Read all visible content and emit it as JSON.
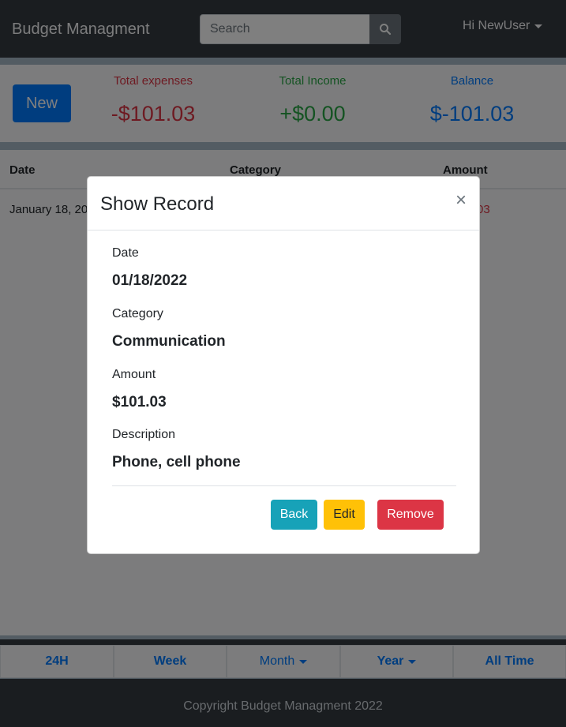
{
  "navbar": {
    "brand": "Budget Managment",
    "search_placeholder": "Search",
    "user_greeting": "Hi NewUser"
  },
  "summary": {
    "new_label": "New",
    "expenses_label": "Total expenses",
    "expenses_value": "-$101.03",
    "income_label": "Total Income",
    "income_value": "+$0.00",
    "balance_label": "Balance",
    "balance_value": "$-101.03"
  },
  "table": {
    "headers": [
      "Date",
      "Category",
      "Amount"
    ],
    "rows": [
      {
        "date": "January 18, 20",
        "amount_tail": "03"
      }
    ]
  },
  "period_tabs": [
    {
      "label": "24H"
    },
    {
      "label": "Week"
    },
    {
      "label": "Month"
    },
    {
      "label": "Year"
    },
    {
      "label": "All Time"
    }
  ],
  "footer": "Copyright Budget Managment 2022",
  "modal": {
    "title": "Show Record",
    "close": "×",
    "fields": [
      {
        "label": "Date",
        "value": "01/18/2022"
      },
      {
        "label": "Category",
        "value": "Communication"
      },
      {
        "label": "Amount",
        "value": "$101.03"
      },
      {
        "label": "Description",
        "value": "Phone, cell phone"
      }
    ],
    "back_label": "Back",
    "edit_label": "Edit",
    "remove_label": "Remove"
  },
  "colors": {
    "primary": "#007bff",
    "danger": "#dc3545",
    "success": "#28a745",
    "info": "#17a2b8",
    "warning": "#ffc107",
    "dark": "#343a40"
  },
  "icons": {
    "search": "search-icon",
    "close": "close-icon"
  }
}
